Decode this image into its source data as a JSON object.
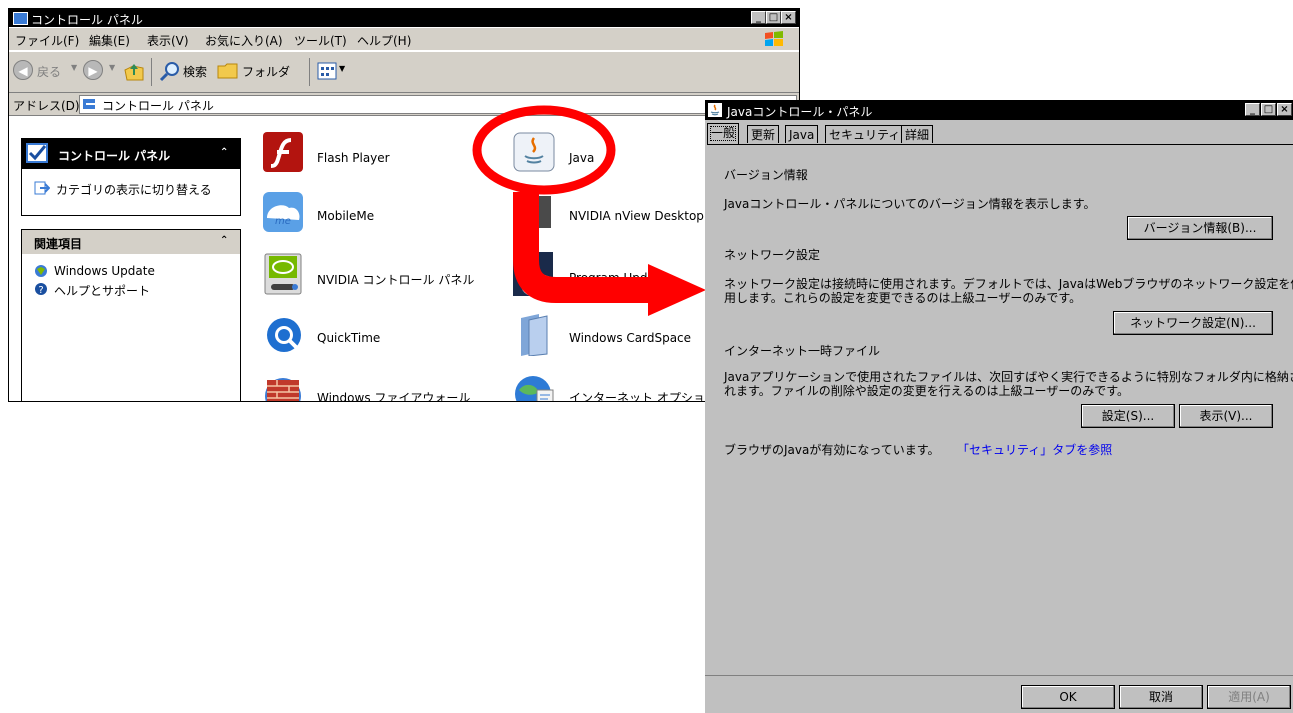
{
  "control_panel": {
    "title": "コントロール パネル",
    "menu": [
      "ファイル(F)",
      "編集(E)",
      "表示(V)",
      "お気に入り(A)",
      "ツール(T)",
      "ヘルプ(H)"
    ],
    "toolbar": {
      "back_label": "戻る",
      "search_label": "検索",
      "folders_label": "フォルダ"
    },
    "address": {
      "label": "アドレス(D)",
      "value": "コントロール パネル"
    },
    "sidebar": {
      "main_panel_title": "コントロール パネル",
      "switch_view_label": "カテゴリの表示に切り替える",
      "related_title": "関連項目",
      "related_items": [
        "Windows Update",
        "ヘルプとサポート"
      ]
    },
    "icons": [
      {
        "name": "flash-player",
        "label": "Flash Player"
      },
      {
        "name": "java",
        "label": "Java"
      },
      {
        "name": "mobileme",
        "label": "MobileMe"
      },
      {
        "name": "nvidia-nview",
        "label": "NVIDIA nView Desktop"
      },
      {
        "name": "nvidia-control",
        "label": "NVIDIA コントロール パネル"
      },
      {
        "name": "program-updates",
        "label": "Program Updates"
      },
      {
        "name": "quicktime",
        "label": "QuickTime"
      },
      {
        "name": "cardspace",
        "label": "Windows CardSpace"
      },
      {
        "name": "firewall",
        "label": "Windows ファイアウォール"
      },
      {
        "name": "internet-options",
        "label": "インターネット オプション"
      }
    ]
  },
  "java_panel": {
    "title": "Javaコントロール・パネル",
    "tabs": [
      "一般",
      "更新",
      "Java",
      "セキュリティ",
      "詳細"
    ],
    "version_section": {
      "heading": "バージョン情報",
      "text": "Javaコントロール・パネルについてのバージョン情報を表示します。",
      "button": "バージョン情報(B)..."
    },
    "network_section": {
      "heading": "ネットワーク設定",
      "text_line1": "ネットワーク設定は接続時に使用されます。デフォルトでは、JavaはWebブラウザのネットワーク設定を使",
      "text_line2": "用します。これらの設定を変更できるのは上級ユーザーのみです。",
      "button": "ネットワーク設定(N)..."
    },
    "temp_files_section": {
      "heading": "インターネット一時ファイル",
      "text_line1": "Javaアプリケーションで使用されたファイルは、次回すばやく実行できるように特別なフォルダ内に格納さ",
      "text_line2": "れます。ファイルの削除や設定の変更を行えるのは上級ユーザーのみです。",
      "settings_button": "設定(S)...",
      "view_button": "表示(V)..."
    },
    "status_text": "ブラウザのJavaが有効になっています。",
    "security_link": "「セキュリティ」タブを参照",
    "footer": {
      "ok": "OK",
      "cancel": "取消",
      "apply": "適用(A)"
    }
  },
  "colors": {
    "highlight_red": "#ff0000",
    "link_blue": "#0000ee"
  }
}
